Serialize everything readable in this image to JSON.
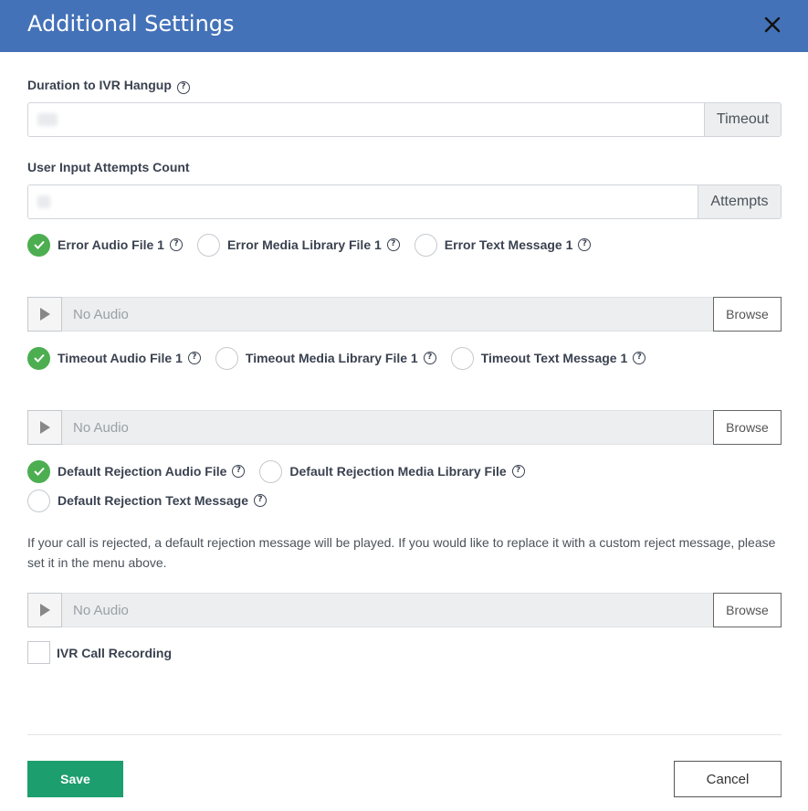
{
  "header": {
    "title": "Additional Settings",
    "close_icon": "close-icon"
  },
  "duration": {
    "label": "Duration to IVR Hangup",
    "value": "",
    "addon": "Timeout"
  },
  "attempts": {
    "label": "User Input Attempts Count",
    "value": "",
    "addon": "Attempts"
  },
  "error": {
    "options": [
      {
        "label": "Error Audio File 1",
        "checked": true
      },
      {
        "label": "Error Media Library File 1",
        "checked": false
      },
      {
        "label": "Error Text Message 1",
        "checked": false
      }
    ],
    "audio": {
      "placeholder": "No Audio",
      "browse": "Browse"
    }
  },
  "timeout": {
    "options": [
      {
        "label": "Timeout Audio File 1",
        "checked": true
      },
      {
        "label": "Timeout Media Library File 1",
        "checked": false
      },
      {
        "label": "Timeout Text Message 1",
        "checked": false
      }
    ],
    "audio": {
      "placeholder": "No Audio",
      "browse": "Browse"
    }
  },
  "rejection": {
    "options": [
      {
        "label": "Default Rejection Audio File",
        "checked": true
      },
      {
        "label": "Default Rejection Media Library File",
        "checked": false
      },
      {
        "label": "Default Rejection Text Message",
        "checked": false
      }
    ],
    "note": "If your call is rejected, a default rejection message will be played. If you would like to replace it with a custom reject message, please set it in the menu above.",
    "audio": {
      "placeholder": "No Audio",
      "browse": "Browse"
    }
  },
  "recording": {
    "label": "IVR Call Recording",
    "checked": false
  },
  "footer": {
    "save": "Save",
    "cancel": "Cancel"
  },
  "colors": {
    "header": "#4472b8",
    "check": "#4cae50",
    "save": "#1d9e6f"
  }
}
